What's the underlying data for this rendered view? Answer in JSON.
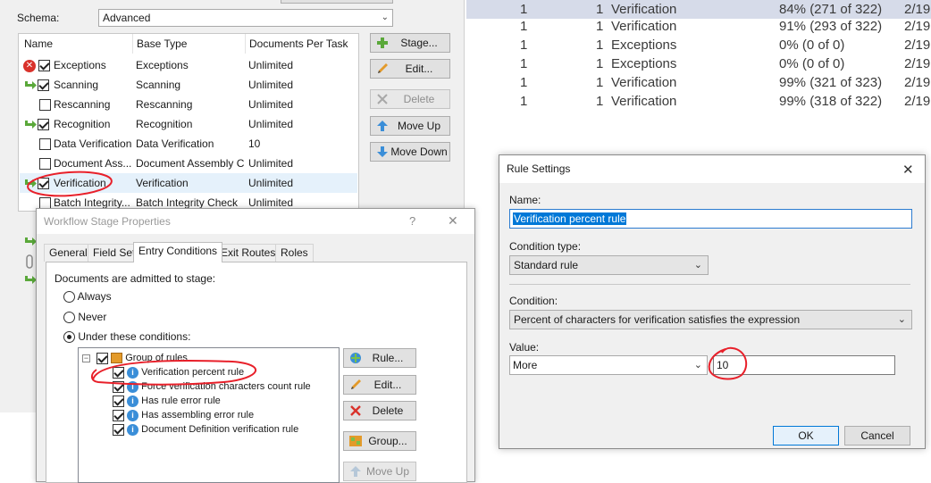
{
  "editor": {
    "schema_label": "Schema:",
    "schema_value": "Advanced",
    "columns": [
      "Name",
      "Base Type",
      "Documents Per Task"
    ],
    "stages": [
      {
        "name": "Exceptions",
        "base": "Exceptions",
        "docs": "Unlimited",
        "checked": true,
        "icon": "error-icon"
      },
      {
        "name": "Scanning",
        "base": "Scanning",
        "docs": "Unlimited",
        "checked": true,
        "icon": "green-arrow-icon"
      },
      {
        "name": "Rescanning",
        "base": "Rescanning",
        "docs": "Unlimited",
        "checked": false,
        "icon": ""
      },
      {
        "name": "Recognition",
        "base": "Recognition",
        "docs": "Unlimited",
        "checked": true,
        "icon": "green-arrow-icon"
      },
      {
        "name": "Data Verification",
        "base": "Data Verification",
        "docs": "10",
        "checked": false,
        "icon": ""
      },
      {
        "name": "Document Ass...",
        "base": "Document Assembly C...",
        "docs": "Unlimited",
        "checked": false,
        "icon": ""
      },
      {
        "name": "Verification",
        "base": "Verification",
        "docs": "Unlimited",
        "checked": true,
        "icon": "green-arrow-icon",
        "selected": true
      },
      {
        "name": "Batch Integrity...",
        "base": "Batch Integrity Check",
        "docs": "Unlimited",
        "checked": false,
        "icon": ""
      }
    ],
    "buttons": {
      "stage": "Stage...",
      "edit": "Edit...",
      "delete": "Delete",
      "move_up": "Move Up",
      "move_down": "Move Down"
    }
  },
  "grid": {
    "rows": [
      {
        "a": "1",
        "b": "1",
        "stage": "Verification",
        "pct": "84% (271 of 322)",
        "date": "2/19",
        "selected": true
      },
      {
        "a": "1",
        "b": "1",
        "stage": "Verification",
        "pct": "91% (293 of 322)",
        "date": "2/19"
      },
      {
        "a": "1",
        "b": "1",
        "stage": "Exceptions",
        "pct": "0% (0 of 0)",
        "date": "2/19"
      },
      {
        "a": "1",
        "b": "1",
        "stage": "Exceptions",
        "pct": "0% (0 of 0)",
        "date": "2/19"
      },
      {
        "a": "1",
        "b": "1",
        "stage": "Verification",
        "pct": "99% (321 of 323)",
        "date": "2/19"
      },
      {
        "a": "1",
        "b": "1",
        "stage": "Verification",
        "pct": "99% (318 of 322)",
        "date": "2/19"
      }
    ]
  },
  "wsp": {
    "title": "Workflow Stage Properties",
    "help": "?",
    "close": "✕",
    "tabs": [
      "General",
      "Field Set",
      "Entry Conditions",
      "Exit Routes",
      "Roles"
    ],
    "intro": "Documents are admitted to stage:",
    "options": [
      "Always",
      "Never",
      "Under these conditions:"
    ],
    "tree_root": "Group of rules",
    "rules": [
      "Verification percent rule",
      "Force verification characters count rule",
      "Has rule error rule",
      "Has assembling error rule",
      "Document Definition verification rule"
    ],
    "buttons": {
      "rule": "Rule...",
      "edit": "Edit...",
      "delete": "Delete",
      "group": "Group...",
      "move_up": "Move Up"
    }
  },
  "rule_settings": {
    "title": "Rule Settings",
    "close": "✕",
    "name_label": "Name:",
    "name_value": "Verification percent rule",
    "condition_type_label": "Condition type:",
    "condition_type_value": "Standard rule",
    "condition_label": "Condition:",
    "condition_value": "Percent of characters for verification satisfies the expression",
    "value_label": "Value:",
    "operator_value": "More",
    "value": "10",
    "ok": "OK",
    "cancel": "Cancel"
  },
  "colors": {
    "annotation": "#e8202a",
    "selection": "#0078d7",
    "grid_selected": "#d6dbe9"
  }
}
